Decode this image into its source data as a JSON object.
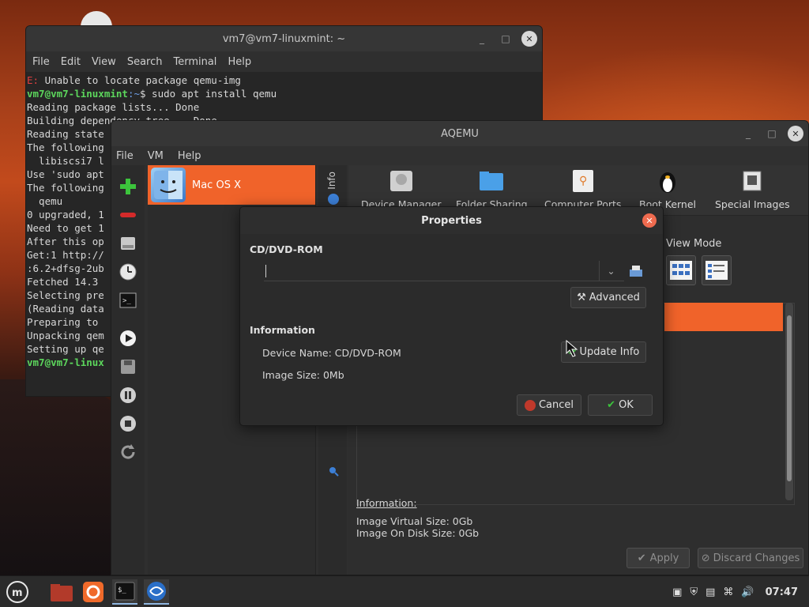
{
  "terminal": {
    "title": "vm7@vm7-linuxmint: ~",
    "menu": [
      "File",
      "Edit",
      "View",
      "Search",
      "Terminal",
      "Help"
    ],
    "lines": [
      {
        "prefix": "E:",
        "text": " Unable to locate package qemu-img"
      },
      {
        "prompt_user": "vm7@vm7-linuxmint",
        "prompt_path": ":~",
        "text": "$ sudo apt install qemu"
      },
      {
        "text": "Reading package lists... Done"
      },
      {
        "text": "Building dependency tree... Done"
      },
      {
        "text": "Reading state"
      },
      {
        "text": "The following"
      },
      {
        "text": "  libiscsi7 l"
      },
      {
        "text": "Use 'sudo apt"
      },
      {
        "text": "The following"
      },
      {
        "text": "  qemu"
      },
      {
        "text": "0 upgraded, 1"
      },
      {
        "text": "Need to get 1"
      },
      {
        "text": "After this op"
      },
      {
        "text": "Get:1 http://"
      },
      {
        "text": ":6.2+dfsg-2ub"
      },
      {
        "text": "Fetched 14.3"
      },
      {
        "text": "Selecting pre"
      },
      {
        "text": "(Reading data"
      },
      {
        "text": "Preparing to"
      },
      {
        "text": "Unpacking qem"
      },
      {
        "text": "Setting up qe"
      },
      {
        "prompt_user": "vm7@vm7-linux",
        "prompt_path": "",
        "text": ""
      }
    ]
  },
  "aqemu": {
    "title": "AQEMU",
    "menu": [
      "File",
      "VM",
      "Help"
    ],
    "vm_name": "Mac OS X",
    "info_tab": "Info",
    "device_tabs": [
      "Device Manager",
      "Folder Sharing",
      "Computer Ports",
      "Boot Kernel",
      "Special Images"
    ],
    "view_mode": "View Mode",
    "info_heading": "Information:",
    "virtual_size": "Image Virtual Size: 0Gb",
    "disk_size": "Image On Disk Size: 0Gb",
    "apply": "Apply",
    "discard": "Discard Changes"
  },
  "dialog": {
    "title": "Properties",
    "section_cdrom": "CD/DVD-ROM",
    "combo_value": "",
    "advanced": "Advanced",
    "section_info": "Information",
    "device_name": "Device Name: CD/DVD-ROM",
    "image_size": "Image Size: 0Mb",
    "update_info": "Update Info",
    "cancel": "Cancel",
    "ok": "OK"
  },
  "taskbar": {
    "clock": "07:47",
    "apps": [
      "menu",
      "files",
      "firefox",
      "terminal",
      "aqemu"
    ]
  },
  "colors": {
    "accent_orange": "#f0632a",
    "terminal_green": "#5cd65c",
    "error_red": "#e04040"
  }
}
